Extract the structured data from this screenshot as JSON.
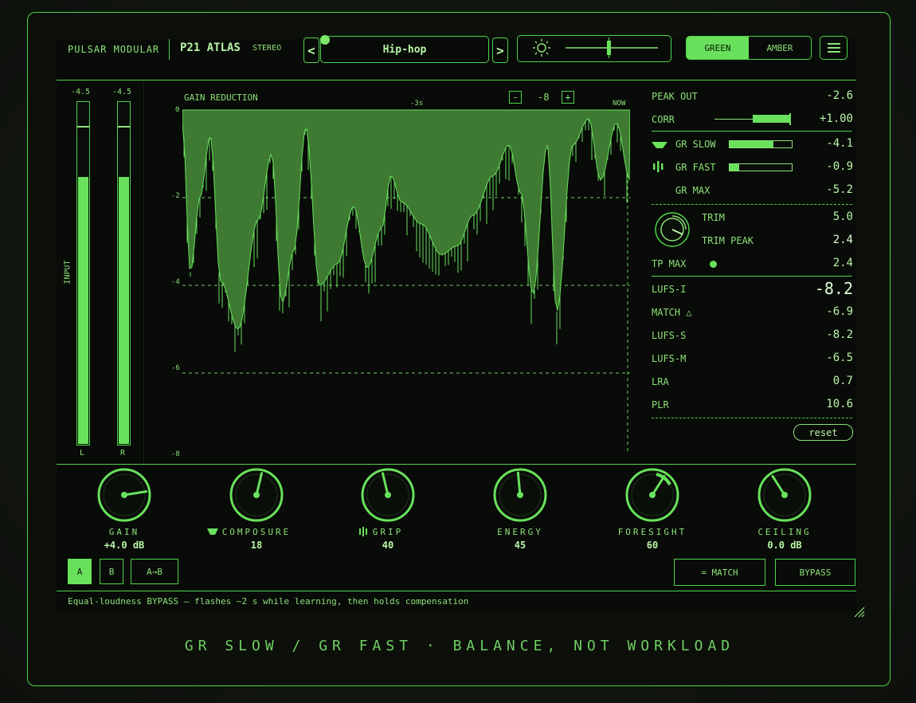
{
  "header": {
    "brand": "PULSAR MODULAR",
    "model": "P21 ATLAS",
    "stereo": "STEREO",
    "prev": "<",
    "next": ">",
    "preset": "Hip-hop",
    "theme_green": "GREEN",
    "theme_amber": "AMBER",
    "theme_selected": "GREEN"
  },
  "meters": {
    "title": "INPUT",
    "left": {
      "readout": "-4.5",
      "label": "L",
      "level": 0.78,
      "peak": 0.93
    },
    "right": {
      "readout": "-4.5",
      "label": "R",
      "level": 0.78,
      "peak": 0.93
    }
  },
  "gr": {
    "title": "GAIN REDUCTION",
    "zoom_minus": "-",
    "zoom_value": "-8",
    "zoom_plus": "+",
    "time_mid": "-3s",
    "time_now": "NOW",
    "y_ticks": [
      "0",
      "-2",
      "-4",
      "-6",
      "-8"
    ]
  },
  "stats": {
    "peak_out": {
      "label": "PEAK OUT",
      "value": "-2.6"
    },
    "corr": {
      "label": "CORR",
      "value": "+1.00",
      "level": 0.5
    },
    "gr_slow": {
      "label": "GR SLOW",
      "value": "-4.1",
      "level": 0.7
    },
    "gr_fast": {
      "label": "GR FAST",
      "value": "-0.9",
      "level": 0.15
    },
    "gr_max": {
      "label": "GR MAX",
      "value": "-5.2"
    },
    "trim": {
      "label": "TRIM",
      "value": "5.0"
    },
    "trim_peak": {
      "label": "TRIM PEAK",
      "value": "2.4"
    },
    "tp_max": {
      "label": "TP MAX",
      "value": "2.4"
    },
    "lufs_i": {
      "label": "LUFS-I",
      "value": "-8.2"
    },
    "match": {
      "label": "MATCH △",
      "value": "-6.9"
    },
    "lufs_s": {
      "label": "LUFS-S",
      "value": "-8.2"
    },
    "lufs_m": {
      "label": "LUFS-M",
      "value": "-6.5"
    },
    "lra": {
      "label": "LRA",
      "value": "0.7"
    },
    "plr": {
      "label": "PLR",
      "value": "10.6"
    },
    "reset": "reset"
  },
  "knobs": [
    {
      "label": "GAIN",
      "value": "+4.0 dB",
      "pos": 0.8
    },
    {
      "label": "COMPOSURE",
      "value": "18",
      "pos": 0.55
    },
    {
      "label": "GRIP",
      "value": "40",
      "pos": 0.45
    },
    {
      "label": "ENERGY",
      "value": "45",
      "pos": 0.48
    },
    {
      "label": "FORESIGHT",
      "value": "60",
      "pos": 0.62
    },
    {
      "label": "CEILING",
      "value": "0.0 dB",
      "pos": 0.38
    }
  ],
  "ab": {
    "a": "A",
    "b": "B",
    "ab_copy": "A→B",
    "selected": "A"
  },
  "actions": {
    "match": "= MATCH",
    "bypass": "BYPASS"
  },
  "status": "Equal-loudness BYPASS — flashes ~2 s while learning, then holds compensation",
  "footer": "GR SLOW / GR FAST · BALANCE, NOT WORKLOAD",
  "colors": {
    "accent": "#69e15c",
    "line": "#4fd24a",
    "text": "#8ee07a",
    "bg": "#080b07"
  }
}
